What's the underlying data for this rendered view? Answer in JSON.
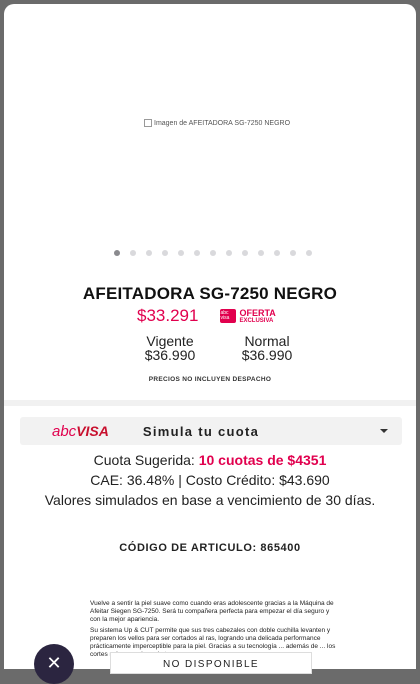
{
  "product": {
    "image_alt": "Imagen de AFEITADORA SG-7250 NEGRO",
    "title": "AFEITADORA SG-7250 NEGRO",
    "price": "$33.291",
    "promo_badge": {
      "logo": "abc visa",
      "line1": "OFERTA",
      "line2": "EXCLUSIVA"
    },
    "vigente_label": "Vigente",
    "vigente_price": "$36.990",
    "normal_label": "Normal",
    "normal_price": "$36.990",
    "disclaimer": "PRECIOS NO INCLUYEN DESPACHO"
  },
  "carousel": {
    "count": 13,
    "active_index": 0
  },
  "simulador": {
    "brand_abc": "abc",
    "brand_visa": "VISA",
    "label": "Simula tu cuota",
    "cuota_prefix": "Cuota Sugerida: ",
    "cuota_value": "10 cuotas de $4351",
    "cae_text": "CAE: 36.48% | Costo Crédito: $43.690",
    "note": "Valores simulados en base a vencimiento de 30 días."
  },
  "codigo": "CÓDIGO DE ARTICULO: 865400",
  "description": {
    "p1": "Vuelve a sentir la piel suave como cuando eras adolescente gracias a la Máquina de Afeitar Siegen SG-7250. Será tu compañera perfecta para empezar el día seguro y con la mejor apariencia.",
    "p2": "Su sistema Up & CUT permite que sus tres cabezales con doble cuchilla levanten y preparen los vellos para ser cortados al ras, logrando una delicada performance prácticamente imperceptible para la piel. Gracias a su tecnología ... además de ... los cortes más ... y a la ... de tu c... ..."
  },
  "actions": {
    "close": "✕",
    "unavailable": "NO DISPONIBLE"
  },
  "colors": {
    "accent": "#e1004e",
    "overlay": "#6b6b6b",
    "close_bg": "#2b2540"
  }
}
